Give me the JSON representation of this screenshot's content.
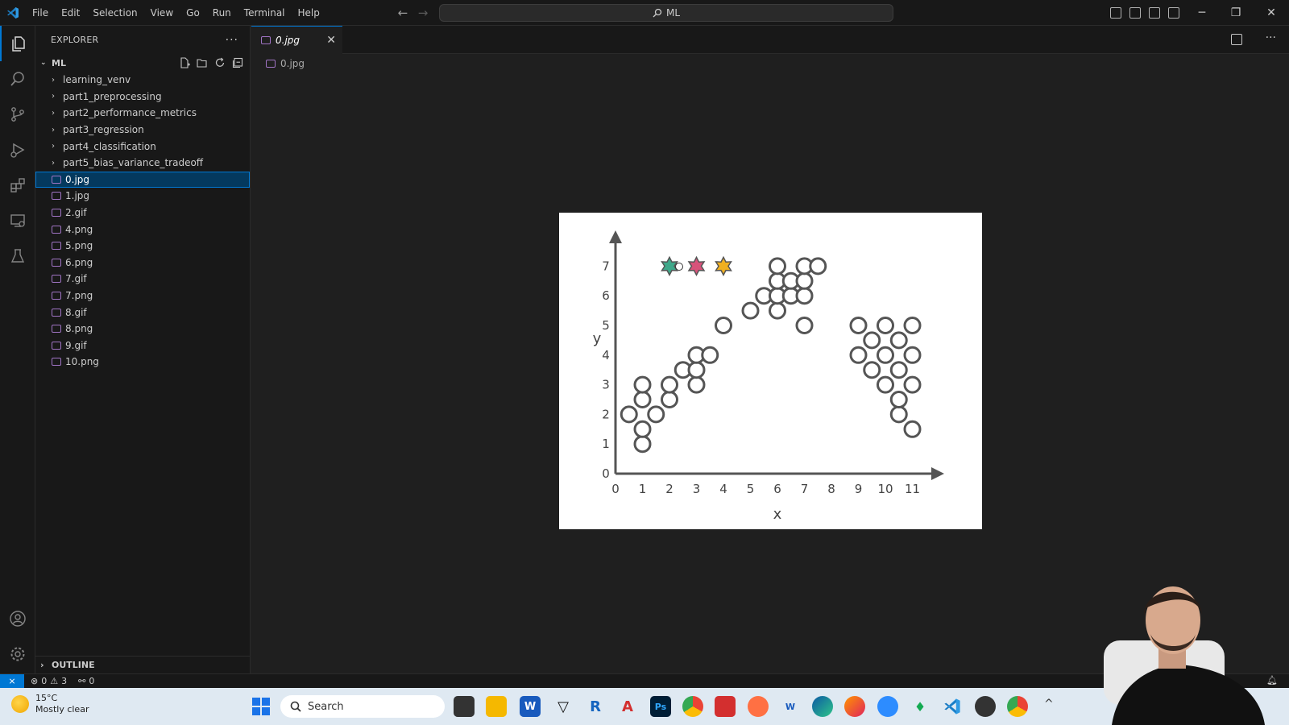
{
  "menu": [
    "File",
    "Edit",
    "Selection",
    "View",
    "Go",
    "Run",
    "Terminal",
    "Help"
  ],
  "command_center": {
    "text": "ML"
  },
  "explorer": {
    "title": "EXPLORER",
    "root": "ML",
    "folders": [
      "learning_venv",
      "part1_preprocessing",
      "part2_performance_metrics",
      "part3_regression",
      "part4_classification",
      "part5_bias_variance_tradeoff"
    ],
    "files": [
      "0.jpg",
      "1.jpg",
      "2.gif",
      "4.png",
      "5.png",
      "6.png",
      "7.gif",
      "7.png",
      "8.gif",
      "8.png",
      "9.gif",
      "10.png"
    ],
    "selected": "0.jpg",
    "outline_label": "OUTLINE"
  },
  "tab": {
    "label": "0.jpg",
    "close": "✕"
  },
  "breadcrumb": {
    "file": "0.jpg"
  },
  "plot": {
    "xlabel": "x",
    "ylabel": "y",
    "x_ticks": [
      "0",
      "1",
      "2",
      "3",
      "4",
      "5",
      "6",
      "7",
      "8",
      "9",
      "10",
      "11"
    ],
    "y_ticks": [
      "0",
      "1",
      "2",
      "3",
      "4",
      "5",
      "6",
      "7"
    ],
    "stars": [
      {
        "x": 2,
        "y": 7,
        "color": "#3fa88a"
      },
      {
        "x": 3,
        "y": 7,
        "color": "#d8527a"
      },
      {
        "x": 4,
        "y": 7,
        "color": "#f0b020"
      }
    ],
    "circles": [
      [
        0.5,
        2
      ],
      [
        1,
        1
      ],
      [
        1,
        1.5
      ],
      [
        1,
        2.5
      ],
      [
        1,
        3
      ],
      [
        1.5,
        2
      ],
      [
        2,
        2.5
      ],
      [
        2,
        3
      ],
      [
        2.5,
        3.5
      ],
      [
        3,
        3
      ],
      [
        3,
        3.5
      ],
      [
        3,
        4
      ],
      [
        3.5,
        4
      ],
      [
        4,
        5
      ],
      [
        5,
        5.5
      ],
      [
        5.5,
        6
      ],
      [
        6,
        5.5
      ],
      [
        6,
        6
      ],
      [
        6,
        6.5
      ],
      [
        6,
        7
      ],
      [
        6.5,
        6
      ],
      [
        6.5,
        6.5
      ],
      [
        7,
        5
      ],
      [
        7,
        6
      ],
      [
        7,
        6.5
      ],
      [
        7,
        7
      ],
      [
        7.5,
        7
      ],
      [
        9,
        4
      ],
      [
        9,
        5
      ],
      [
        9.5,
        3.5
      ],
      [
        9.5,
        4.5
      ],
      [
        10,
        3
      ],
      [
        10,
        4
      ],
      [
        10,
        5
      ],
      [
        10.5,
        2
      ],
      [
        10.5,
        2.5
      ],
      [
        10.5,
        3.5
      ],
      [
        10.5,
        4.5
      ],
      [
        11,
        1.5
      ],
      [
        11,
        3
      ],
      [
        11,
        4
      ],
      [
        11,
        5
      ]
    ]
  },
  "status": {
    "errors": "0",
    "warnings": "3",
    "ports": "0"
  },
  "taskbar": {
    "temperature": "15°C",
    "condition": "Mostly clear",
    "search_placeholder": "Search"
  }
}
